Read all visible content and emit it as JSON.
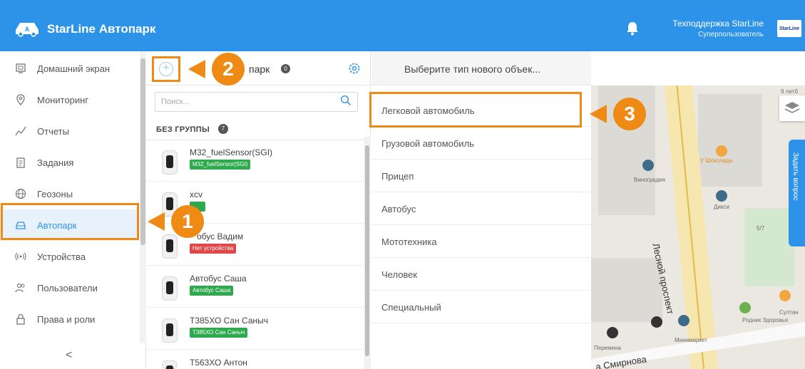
{
  "header": {
    "app_title": "StarLine Автопарк",
    "support_name": "Техподдержка StarLine",
    "support_role": "Суперпользователь",
    "brand_badge": "StarLine",
    "accent_color": "#2d93e8"
  },
  "sidebar": {
    "items": [
      {
        "label": "Домашний экран",
        "icon": "home-screen-icon"
      },
      {
        "label": "Мониторинг",
        "icon": "location-pin-icon"
      },
      {
        "label": "Отчеты",
        "icon": "chart-line-icon"
      },
      {
        "label": "Задания",
        "icon": "clipboard-icon"
      },
      {
        "label": "Геозоны",
        "icon": "globe-icon"
      },
      {
        "label": "Автопарк",
        "icon": "car-icon",
        "active": true
      },
      {
        "label": "Устройства",
        "icon": "signal-icon"
      },
      {
        "label": "Пользователи",
        "icon": "users-icon"
      },
      {
        "label": "Права и роли",
        "icon": "lock-icon"
      }
    ],
    "collapse_glyph": "<"
  },
  "panel": {
    "title": "парк",
    "count": "0",
    "search_placeholder": "Поиск...",
    "group_title": "БЕЗ ГРУППЫ",
    "group_count": "7",
    "vehicles": [
      {
        "name": "M32_fuelSensor(SGI)",
        "tag": "M32_fuelSensor(SGI)",
        "tag_color": "green"
      },
      {
        "name": "xcv",
        "tag": "",
        "tag_color": "green"
      },
      {
        "name": "обус Вадим",
        "tag": "Нет устройства",
        "tag_color": "red"
      },
      {
        "name": "Автобус Саша",
        "tag": "Автобус Саша",
        "tag_color": "green"
      },
      {
        "name": "Т385ХО Сан Саныч",
        "tag": "Т385ХО Сан Саныч",
        "tag_color": "green"
      },
      {
        "name": "Т563ХО Антон",
        "tag": "",
        "tag_color": "green"
      }
    ]
  },
  "type_menu": {
    "title": "Выберите тип нового объек...",
    "options": [
      "Легковой автомобиль",
      "Грузовой автомобиль",
      "Прицеп",
      "Автобус",
      "Мототехника",
      "Человек",
      "Специальный"
    ]
  },
  "map": {
    "labels": [
      "9 литб",
      "У Шоколада",
      "Виноградия",
      "Дикси",
      "5/7",
      "Султан",
      "Родник Здоровья",
      "Минимаркет",
      "Перемена"
    ],
    "street_main": "Лесной проспект",
    "street_bottom": "а Смирнова",
    "ask_tab": "Задать вопрос"
  },
  "annotations": {
    "callouts": [
      "1",
      "2",
      "3"
    ],
    "highlight_color": "#ef8a14"
  }
}
